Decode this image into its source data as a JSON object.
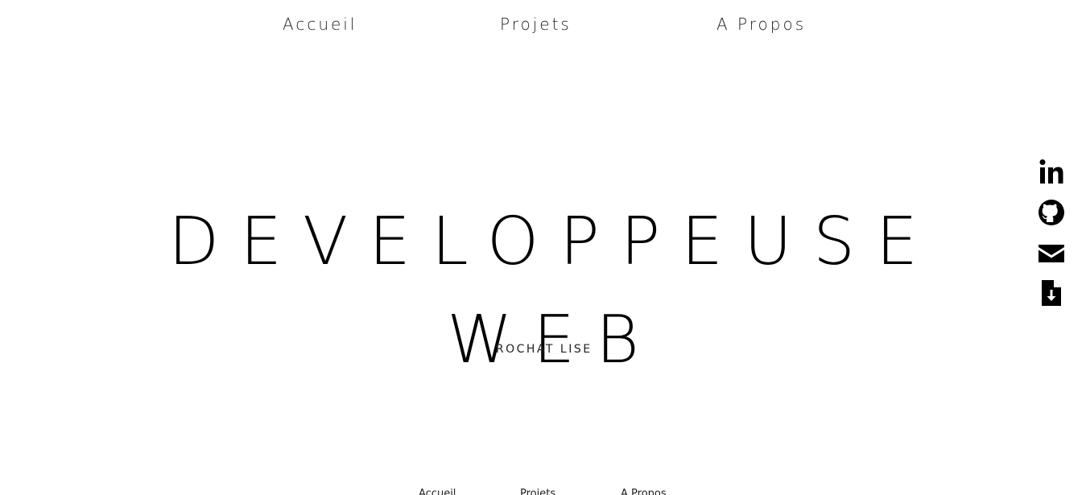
{
  "nav": {
    "accueil": "Accueil",
    "projets": "Projets",
    "apropos": "A Propos"
  },
  "hero": {
    "title_line1": "DEVELOPPEUSE",
    "title_line2": "WEB",
    "subtitle": "ROCHAT LISE"
  },
  "social": [
    {
      "icon": "linkedin-icon"
    },
    {
      "icon": "github-icon"
    },
    {
      "icon": "mail-icon"
    },
    {
      "icon": "download-cv-icon"
    }
  ],
  "footer_nav": {
    "accueil": "Accueil",
    "projets": "Projets",
    "apropos": "A Propos"
  },
  "colors": {
    "background": "#ffffff",
    "text": "#000000"
  }
}
